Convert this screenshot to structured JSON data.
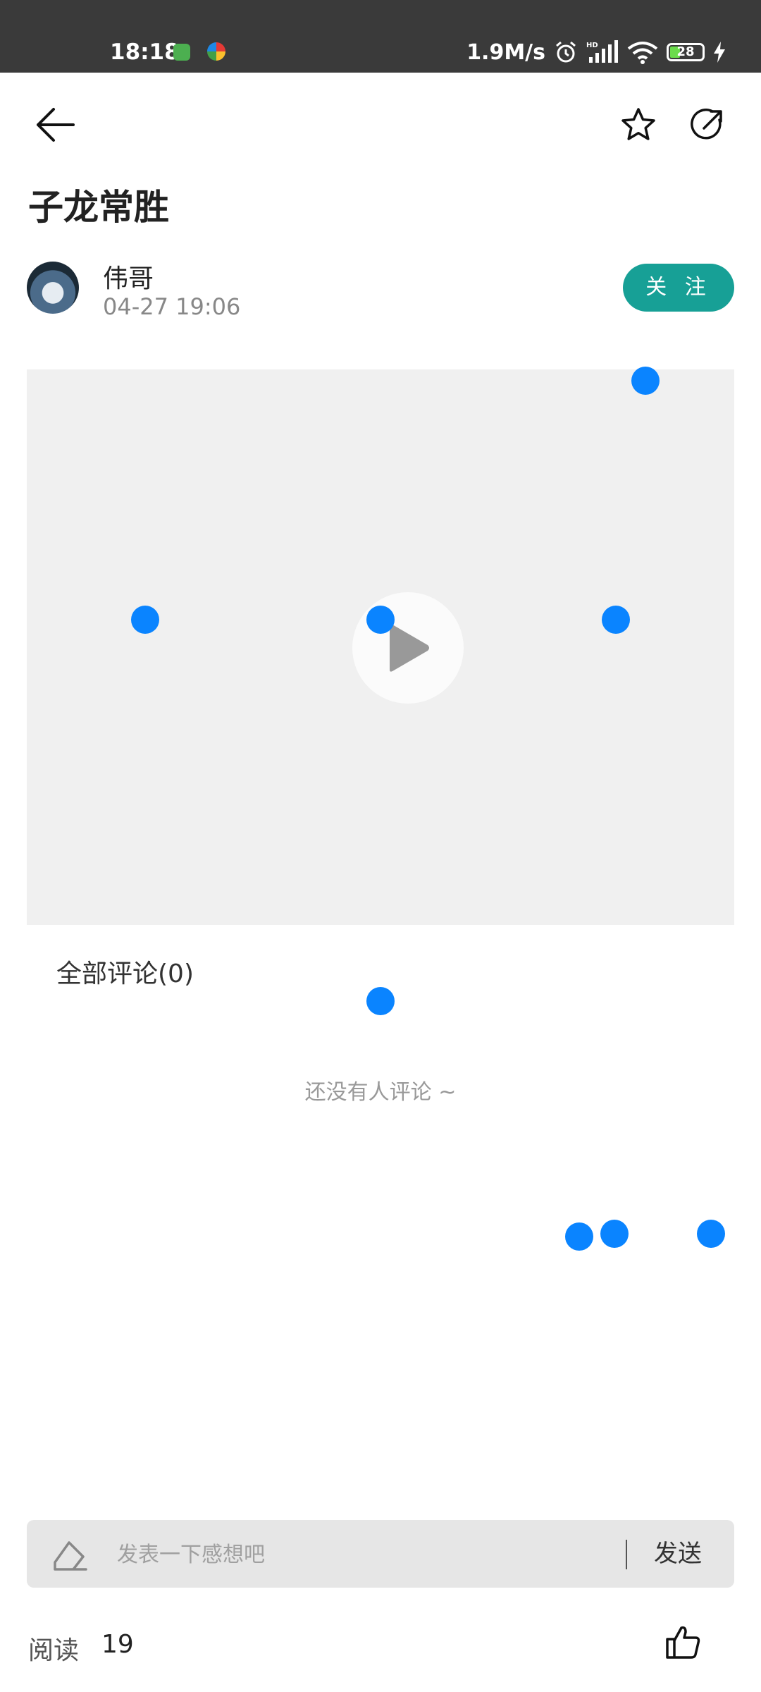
{
  "status_bar": {
    "time": "18:18",
    "network_speed": "1.9M/s",
    "signal_label": "HD",
    "battery": "28"
  },
  "header": {
    "back_icon": "arrow-left-icon",
    "favorite_icon": "star-icon",
    "share_icon": "share-icon"
  },
  "post": {
    "title": "子龙常胜",
    "author": {
      "name": "伟哥",
      "timestamp": "04-27 19:06"
    },
    "follow_label": "关 注"
  },
  "video": {
    "play_icon": "play-icon"
  },
  "comments": {
    "title": "全部评论(0)",
    "empty_text": "还没有人评论 ~"
  },
  "comment_input": {
    "placeholder": "发表一下感想吧",
    "value": "",
    "send_label": "发送"
  },
  "footer": {
    "read_label": "阅读",
    "read_count": "19",
    "like_icon": "thumbs-up-icon"
  },
  "colors": {
    "accent": "#17a096",
    "status_bar": "#3a3a3a",
    "video_bg": "#f0f0f0",
    "touch_dot": "#0a84ff"
  }
}
